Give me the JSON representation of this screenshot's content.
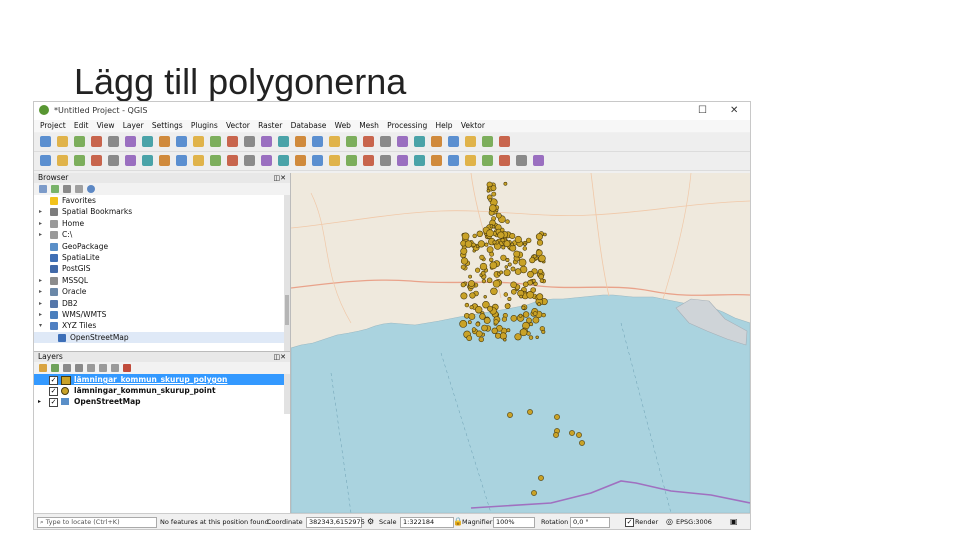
{
  "slide": {
    "title": "Lägg till polygonerna"
  },
  "window": {
    "title": "*Untitled Project - QGIS",
    "maximize_glyph": "☐",
    "close_glyph": "✕"
  },
  "menu": [
    "Project",
    "Edit",
    "View",
    "Layer",
    "Settings",
    "Plugins",
    "Vector",
    "Raster",
    "Database",
    "Web",
    "Mesh",
    "Processing",
    "Help",
    "Vektor"
  ],
  "toolbar_icons": {
    "row1": [
      "new-project-icon",
      "open-project-icon",
      "save-project-icon",
      "save-as-icon",
      "print-layout-icon",
      "layout-manager-icon",
      "pan-icon",
      "pan-to-selection-icon",
      "zoom-in-icon",
      "zoom-out-icon",
      "zoom-full-icon",
      "zoom-selection-icon",
      "zoom-layer-icon",
      "zoom-last-icon",
      "zoom-next-icon",
      "new-map-view-icon",
      "temporal-icon",
      "refresh-icon",
      "identify-icon",
      "select-icon",
      "deselect-icon",
      "attribute-table-icon",
      "field-calculator-icon",
      "processing-icon",
      "statistics-icon",
      "measure-icon",
      "annotation-icon",
      "text-annotation-icon"
    ],
    "row2": [
      "data-source-manager-icon",
      "new-geopackage-icon",
      "vector-icon",
      "add-raster-icon",
      "add-mesh-icon",
      "add-wms-icon",
      "open-field-icon",
      "digitize-icon",
      "edit-pencil-icon",
      "save-edits-icon",
      "add-feature-icon",
      "move-feature-icon",
      "vertex-tool-icon",
      "delete-icon",
      "cut-icon",
      "copy-icon",
      "paste-icon",
      "undo-icon",
      "redo-icon",
      "label-icon",
      "pin-label-icon",
      "show-labels-icon",
      "move-label-icon",
      "rotate-label-icon",
      "change-label-icon",
      "label-tools-icon",
      "diagram-icon",
      "plugin-icon",
      "python-icon",
      "help-icon"
    ]
  },
  "browser": {
    "title": "Browser",
    "items": [
      {
        "label": "Favorites",
        "icon": "star-icon",
        "color": "#f2c21b"
      },
      {
        "label": "Spatial Bookmarks",
        "icon": "bookmark-icon",
        "color": "#7d7d7d"
      },
      {
        "label": "Home",
        "icon": "home-icon",
        "color": "#9a9a9a"
      },
      {
        "label": "C:\\",
        "icon": "drive-icon",
        "color": "#9a9a9a"
      },
      {
        "label": "GeoPackage",
        "icon": "geopackage-icon",
        "color": "#5a8fc8"
      },
      {
        "label": "SpatiaLite",
        "icon": "spatialite-icon",
        "color": "#3f6fb5"
      },
      {
        "label": "PostGIS",
        "icon": "postgis-icon",
        "color": "#4169a8"
      },
      {
        "label": "MSSQL",
        "icon": "mssql-icon",
        "color": "#8c8c8c"
      },
      {
        "label": "Oracle",
        "icon": "oracle-icon",
        "color": "#6b88a8"
      },
      {
        "label": "DB2",
        "icon": "db2-icon",
        "color": "#5577aa"
      },
      {
        "label": "WMS/WMTS",
        "icon": "wms-icon",
        "color": "#4b7fbd"
      },
      {
        "label": "XYZ Tiles",
        "icon": "xyz-tiles-icon",
        "color": "#4f80c2"
      },
      {
        "label": "OpenStreetMap",
        "icon": "tile-layer-icon",
        "color": "#3d6fb8"
      }
    ]
  },
  "layers": {
    "title": "Layers",
    "items": [
      {
        "label": "lämningar_kommun_skurup_polygon",
        "checked": "✓",
        "icon": "polygon-layer-icon",
        "selected": true
      },
      {
        "label": "lämningar_kommun_skurup_point",
        "checked": "✓",
        "icon": "point-layer-icon",
        "selected": false
      },
      {
        "label": "OpenStreetMap",
        "checked": "✓",
        "icon": "raster-layer-icon",
        "selected": false
      }
    ]
  },
  "status": {
    "locate_placeholder": "Type to locate (Ctrl+K)",
    "message": "No features at this position found.",
    "coordinate_label": "Coordinate",
    "coordinate_value": "382343,6152975",
    "scale_label": "Scale",
    "scale_value": "1:322184",
    "magnifier_label": "Magnifier",
    "magnifier_value": "100%",
    "rotation_label": "Rotation",
    "rotation_value": "0,0 °",
    "render_label": "Render",
    "crs_label": "EPSG:3006"
  },
  "colors": {
    "land": "#efe9dd",
    "sea": "#aad3df",
    "feature_fill": "#c9a227",
    "feature_stroke": "#4a3b0c",
    "road": "#e9a28a",
    "border": "#a070c0",
    "selection": "#3399ff"
  }
}
